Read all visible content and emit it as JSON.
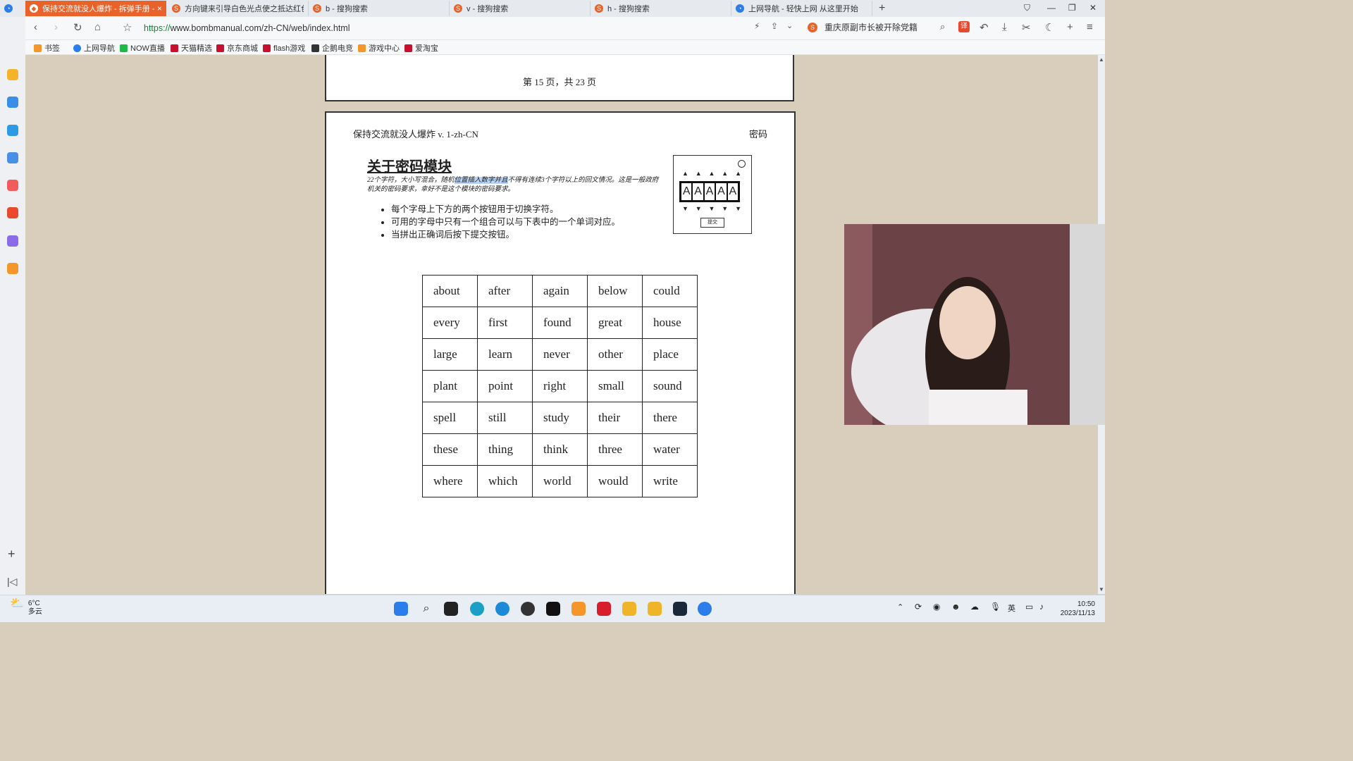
{
  "browser": {
    "tabs": [
      {
        "label": "保持交流就没人爆炸 - 拆弹手册 - zh"
      },
      {
        "label": "方向键来引导白色光点使之抵达红色..."
      },
      {
        "label": "b - 搜狗搜索"
      },
      {
        "label": "v - 搜狗搜索"
      },
      {
        "label": "h - 搜狗搜索"
      },
      {
        "label": "上网导航 - 轻快上网 从这里开始"
      }
    ],
    "url_scheme": "https://",
    "url_rest": "www.bombmanual.com/zh-CN/web/index.html",
    "news_text": "重庆原副市长被开除党籍",
    "bookmarks": [
      "书签",
      "上网导航",
      "NOW直播",
      "天猫精选",
      "京东商城",
      "flash游戏",
      "企鹅电竞",
      "游戏中心",
      "爱淘宝"
    ]
  },
  "manual": {
    "page_indicator": "第 15 页，共 23 页",
    "header_left": "保持交流就没人爆炸 v. 1-zh-CN",
    "header_right": "密码",
    "title": "关于密码模块",
    "desc_a": "22个字符，大小写混合，随机",
    "desc_highlight": "位置插入数字并且",
    "desc_b": "不得有连续3个字符以上的回文情况。这是一般政府机关的密码要求，幸好不是这个模块的密码要求。",
    "bullets": [
      "每个字母上下方的两个按钮用于切换字符。",
      "可用的字母中只有一个组合可以与下表中的一个单词对应。",
      "当拼出正确词后按下提交按钮。"
    ],
    "module_letters": [
      "A",
      "A",
      "A",
      "A",
      "A"
    ],
    "module_submit": "提交",
    "words": [
      [
        "about",
        "after",
        "again",
        "below",
        "could"
      ],
      [
        "every",
        "first",
        "found",
        "great",
        "house"
      ],
      [
        "large",
        "learn",
        "never",
        "other",
        "place"
      ],
      [
        "plant",
        "point",
        "right",
        "small",
        "sound"
      ],
      [
        "spell",
        "still",
        "study",
        "their",
        "there"
      ],
      [
        "these",
        "thing",
        "think",
        "three",
        "water"
      ],
      [
        "where",
        "which",
        "world",
        "would",
        "write"
      ]
    ]
  },
  "taskbar": {
    "temp": "6°C",
    "weather": "多云",
    "time": "10:50",
    "date": "2023/11/13",
    "ime": "英"
  },
  "colors": {
    "accent": "#e8622a",
    "page_bg": "#d9cdbb",
    "highlight": "#b8d3f5"
  }
}
